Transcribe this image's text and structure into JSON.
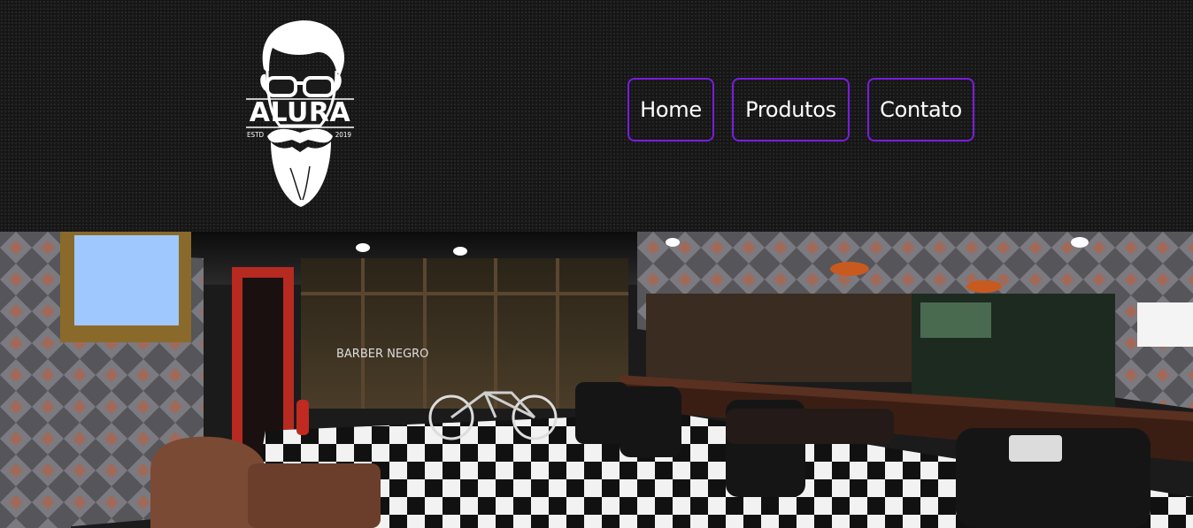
{
  "brand": {
    "name": "ALURA",
    "estd_label": "ESTD",
    "year": "2019",
    "logo_icon": "bearded-man-with-glasses"
  },
  "nav": {
    "items": [
      {
        "label": "Home"
      },
      {
        "label": "Produtos"
      },
      {
        "label": "Contato"
      }
    ],
    "border_color": "#7a1ce0"
  },
  "hero": {
    "image_subject": "barbershop interior with barber chairs and checkered floor",
    "window_text": "BARBER NEGRO"
  },
  "colors": {
    "header_bg": "#1a1a1a",
    "text": "#ffffff",
    "accent": "#7a1ce0"
  }
}
